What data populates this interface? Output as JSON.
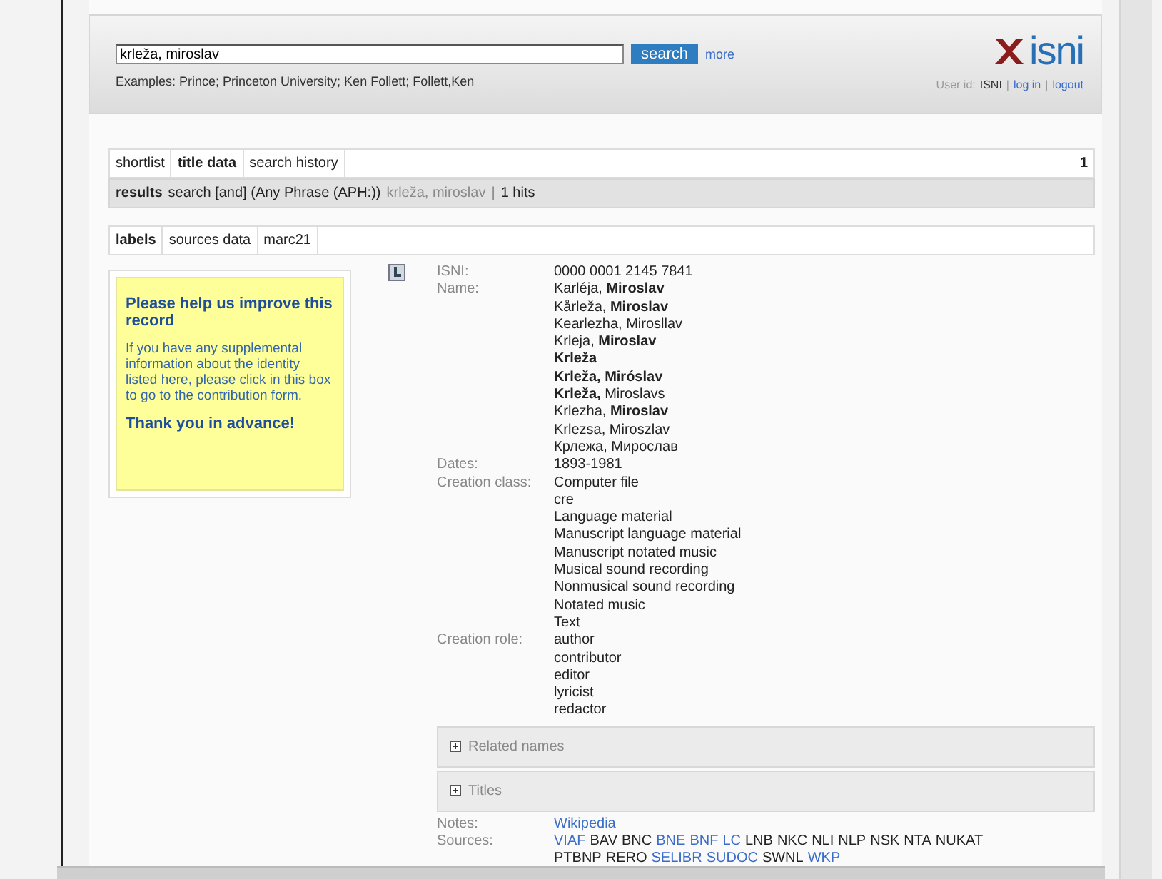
{
  "search": {
    "value": "krleža, miroslav",
    "button": "search",
    "more": "more",
    "examples": "Examples: Prince; Princeton University; Ken Follett; Follett,Ken"
  },
  "logo": {
    "text": "isni"
  },
  "user": {
    "label": "User id:",
    "id": "ISNI",
    "login": "log in",
    "separator": "|",
    "logout": "logout"
  },
  "tabs": [
    {
      "label": "shortlist",
      "selected": false
    },
    {
      "label": "title data",
      "selected": true
    },
    {
      "label": "search history",
      "selected": false
    }
  ],
  "page_count": "1",
  "results": {
    "label": "results",
    "query": "search [and] (Any Phrase (APH:))",
    "term": "krleža, miroslav",
    "separator": "|",
    "hits": "1 hits"
  },
  "subtabs": [
    {
      "label": "labels",
      "selected": true
    },
    {
      "label": "sources data",
      "selected": false
    },
    {
      "label": "marc21",
      "selected": false
    }
  ],
  "help_box": {
    "title": "Please help us improve this record",
    "body": "If you have any supplemental information about the identity listed here, please click in this box to go to the contribution form.",
    "thanks": "Thank you in advance!"
  },
  "fields": [
    {
      "label": "ISNI:",
      "values": [
        "0000 0001 2145 7841"
      ]
    },
    {
      "label": "Name:",
      "values": [
        "Karléja, **Miroslav**",
        "Kårleža, **Miroslav**",
        "Kearlezha, Mirosllav",
        "Krleja, **Miroslav**",
        "**Krleža**",
        "**Krleža, Miróslav**",
        "**Krleža,** Miroslavs",
        "Krlezha, **Miroslav**",
        "Krlezsa, Miroszlav",
        "Крлежа, Мирослав"
      ]
    },
    {
      "label": "Dates:",
      "values": [
        "1893-1981"
      ]
    },
    {
      "label": "Creation class:",
      "values": [
        "Computer file",
        "cre",
        "Language material",
        "Manuscript language material",
        "Manuscript notated music",
        "Musical sound recording",
        "Nonmusical sound recording",
        "Notated music",
        "Text"
      ]
    },
    {
      "label": "Creation role:",
      "values": [
        "author",
        "contributor",
        "editor",
        "lyricist",
        "redactor"
      ]
    }
  ],
  "sections": [
    {
      "label": "Related names",
      "expanded": false
    },
    {
      "label": "Titles",
      "expanded": false
    }
  ],
  "notes": {
    "label": "Notes:",
    "link": "Wikipedia"
  },
  "sources": {
    "label": "Sources:",
    "items": [
      {
        "text": "VIAF",
        "link": true
      },
      {
        "text": "BAV",
        "link": false
      },
      {
        "text": "BNC",
        "link": false
      },
      {
        "text": "BNE",
        "link": true
      },
      {
        "text": "BNF",
        "link": true
      },
      {
        "text": "LC",
        "link": true
      },
      {
        "text": "LNB",
        "link": false
      },
      {
        "text": "NKC",
        "link": false
      },
      {
        "text": "NLI",
        "link": false
      },
      {
        "text": "NLP",
        "link": false
      },
      {
        "text": "NSK",
        "link": false
      },
      {
        "text": "NTA",
        "link": false
      },
      {
        "text": "NUKAT",
        "link": false
      },
      {
        "text": "PTBNP",
        "link": false
      },
      {
        "text": "RERO",
        "link": false
      },
      {
        "text": "SELIBR",
        "link": true
      },
      {
        "text": "SUDOC",
        "link": true
      },
      {
        "text": "SWNL",
        "link": false
      },
      {
        "text": "WKP",
        "link": true
      }
    ]
  }
}
